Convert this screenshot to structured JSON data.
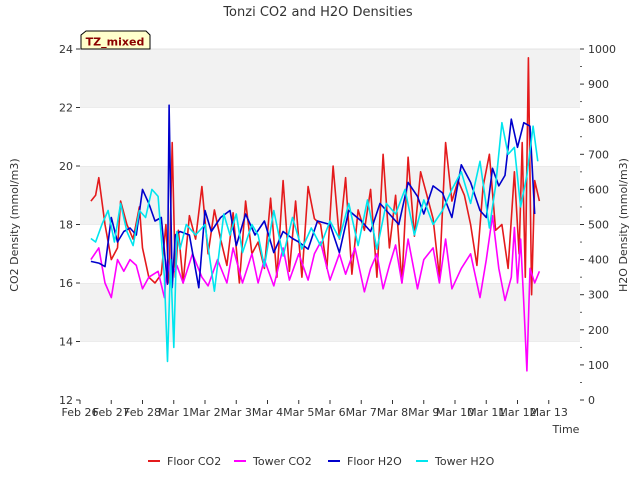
{
  "chart_data": {
    "type": "line",
    "title": "Tonzi CO2 and H2O Densities",
    "xlabel": "Time",
    "ylabel_left": "CO2 Density (mmol/m3)",
    "ylabel_right": "H2O Density (mmol/m3)",
    "ylim_left": [
      12,
      24
    ],
    "ylim_right": [
      0,
      1000
    ],
    "yticks_left": [
      "12",
      "14",
      "16",
      "18",
      "20",
      "22",
      "24"
    ],
    "yticks_right": [
      "0",
      "100",
      "200",
      "300",
      "400",
      "500",
      "600",
      "700",
      "800",
      "900",
      "1000"
    ],
    "xlim": [
      0,
      16
    ],
    "xticks": [
      "Feb 26",
      "Feb 27",
      "Feb 28",
      "Mar 1",
      "Mar 2",
      "Mar 3",
      "Mar 4",
      "Mar 5",
      "Mar 6",
      "Mar 7",
      "Mar 8",
      "Mar 9",
      "Mar 10",
      "Mar 11",
      "Mar 12",
      "Mar 13"
    ],
    "grid": "horizontal bands",
    "legend_placement": "bottom",
    "annotation": "TZ_mixed",
    "series": [
      {
        "name": "Floor CO2",
        "axis": "left",
        "color": "#e41a1c",
        "x": [
          0.35,
          0.5,
          0.6,
          0.8,
          1.0,
          1.2,
          1.3,
          1.5,
          1.7,
          1.9,
          2.0,
          2.2,
          2.4,
          2.6,
          2.75,
          2.85,
          2.95,
          3.05,
          3.15,
          3.3,
          3.5,
          3.7,
          3.9,
          4.1,
          4.3,
          4.5,
          4.7,
          4.9,
          5.1,
          5.3,
          5.5,
          5.7,
          5.9,
          6.1,
          6.3,
          6.5,
          6.7,
          6.9,
          7.1,
          7.3,
          7.5,
          7.7,
          7.9,
          8.1,
          8.3,
          8.5,
          8.7,
          8.9,
          9.1,
          9.3,
          9.5,
          9.7,
          9.9,
          10.1,
          10.3,
          10.5,
          10.7,
          10.9,
          11.1,
          11.3,
          11.5,
          11.7,
          11.9,
          12.1,
          12.3,
          12.5,
          12.7,
          12.9,
          13.1,
          13.3,
          13.5,
          13.7,
          13.9,
          14.05,
          14.15,
          14.25,
          14.35,
          14.45,
          14.55,
          14.7
        ],
        "values": [
          18.8,
          19.0,
          19.6,
          18.0,
          16.8,
          17.2,
          18.8,
          18.0,
          17.5,
          18.6,
          17.2,
          16.2,
          16.0,
          16.3,
          18.0,
          16.0,
          20.8,
          16.2,
          17.8,
          16.0,
          18.3,
          17.5,
          19.3,
          17.0,
          18.5,
          17.5,
          16.6,
          18.4,
          16.0,
          18.8,
          17.0,
          17.4,
          16.5,
          18.9,
          16.2,
          19.5,
          16.4,
          18.8,
          16.2,
          19.3,
          18.2,
          18.0,
          16.5,
          20.0,
          17.5,
          19.6,
          16.3,
          18.5,
          17.8,
          19.2,
          16.2,
          20.4,
          17.2,
          19.0,
          16.0,
          20.3,
          17.6,
          19.8,
          19.0,
          18.2,
          16.2,
          20.8,
          18.8,
          19.5,
          19.0,
          18.0,
          16.6,
          19.3,
          20.4,
          17.8,
          18.0,
          16.5,
          19.8,
          17.0,
          20.8,
          16.2,
          23.7,
          15.6,
          19.5,
          18.8
        ]
      },
      {
        "name": "Tower CO2",
        "axis": "left",
        "color": "#ff00ff",
        "x": [
          0.35,
          0.6,
          0.8,
          1.0,
          1.2,
          1.4,
          1.6,
          1.8,
          2.0,
          2.2,
          2.5,
          2.7,
          2.8,
          2.9,
          3.1,
          3.3,
          3.6,
          3.9,
          4.1,
          4.4,
          4.7,
          4.9,
          5.2,
          5.5,
          5.7,
          5.9,
          6.2,
          6.5,
          6.7,
          7.0,
          7.3,
          7.5,
          7.7,
          8.0,
          8.3,
          8.5,
          8.8,
          9.1,
          9.3,
          9.5,
          9.7,
          9.9,
          10.1,
          10.3,
          10.5,
          10.8,
          11.0,
          11.3,
          11.5,
          11.7,
          11.9,
          12.2,
          12.5,
          12.8,
          13.0,
          13.2,
          13.4,
          13.6,
          13.8,
          13.9,
          14.0,
          14.1,
          14.2,
          14.3,
          14.4,
          14.55,
          14.7
        ],
        "values": [
          16.8,
          17.2,
          16.0,
          15.5,
          16.8,
          16.4,
          16.8,
          16.6,
          15.8,
          16.2,
          16.4,
          15.5,
          16.8,
          16.2,
          16.6,
          16.0,
          17.0,
          16.2,
          15.9,
          16.8,
          16.0,
          17.2,
          16.0,
          17.0,
          16.0,
          16.8,
          15.9,
          17.2,
          16.1,
          17.0,
          16.1,
          17.0,
          17.4,
          16.1,
          17.0,
          16.3,
          17.2,
          15.7,
          16.5,
          17.0,
          15.8,
          16.6,
          17.3,
          16.0,
          17.5,
          15.8,
          16.8,
          17.2,
          16.0,
          17.5,
          15.8,
          16.5,
          17.0,
          15.5,
          16.8,
          18.3,
          16.5,
          15.4,
          16.2,
          17.9,
          16.0,
          17.5,
          15.3,
          13.0,
          16.5,
          16.0,
          16.4
        ]
      },
      {
        "name": "Floor H2O",
        "axis": "right",
        "color": "#0000cc",
        "x": [
          0.35,
          0.6,
          0.8,
          1.0,
          1.2,
          1.4,
          1.6,
          1.8,
          2.0,
          2.2,
          2.4,
          2.6,
          2.8,
          2.85,
          2.95,
          3.05,
          3.2,
          3.5,
          3.8,
          4.0,
          4.2,
          4.5,
          4.8,
          5.0,
          5.3,
          5.6,
          5.9,
          6.2,
          6.5,
          6.8,
          7.0,
          7.3,
          7.6,
          8.0,
          8.3,
          8.6,
          9.0,
          9.3,
          9.6,
          9.9,
          10.2,
          10.5,
          10.8,
          11.0,
          11.3,
          11.6,
          11.9,
          12.2,
          12.5,
          12.8,
          13.0,
          13.2,
          13.4,
          13.6,
          13.8,
          14.0,
          14.2,
          14.4,
          14.55
        ],
        "values": [
          395,
          390,
          380,
          520,
          450,
          480,
          490,
          470,
          600,
          560,
          510,
          520,
          330,
          840,
          320,
          470,
          480,
          470,
          320,
          540,
          480,
          520,
          540,
          440,
          530,
          470,
          510,
          420,
          480,
          460,
          450,
          430,
          510,
          500,
          420,
          540,
          510,
          480,
          560,
          530,
          500,
          620,
          580,
          530,
          610,
          590,
          520,
          670,
          620,
          540,
          520,
          660,
          610,
          640,
          800,
          720,
          790,
          780,
          530
        ]
      },
      {
        "name": "Tower H2O",
        "axis": "right",
        "color": "#00e5ee",
        "x": [
          0.35,
          0.5,
          0.7,
          0.9,
          1.1,
          1.3,
          1.5,
          1.7,
          1.9,
          2.1,
          2.3,
          2.5,
          2.7,
          2.8,
          2.9,
          3.0,
          3.1,
          3.2,
          3.4,
          3.7,
          4.0,
          4.3,
          4.6,
          4.8,
          5.0,
          5.2,
          5.5,
          5.7,
          5.9,
          6.2,
          6.5,
          6.8,
          7.1,
          7.4,
          7.7,
          8.0,
          8.3,
          8.6,
          8.9,
          9.2,
          9.5,
          9.8,
          10.1,
          10.4,
          10.7,
          11.0,
          11.3,
          11.6,
          11.9,
          12.2,
          12.5,
          12.8,
          13.1,
          13.3,
          13.5,
          13.7,
          13.9,
          14.1,
          14.3,
          14.5,
          14.65
        ],
        "values": [
          460,
          450,
          500,
          540,
          450,
          560,
          480,
          440,
          540,
          520,
          600,
          580,
          350,
          110,
          400,
          150,
          480,
          430,
          500,
          470,
          500,
          310,
          530,
          470,
          530,
          420,
          500,
          470,
          380,
          540,
          410,
          520,
          430,
          490,
          440,
          510,
          460,
          560,
          440,
          570,
          430,
          560,
          530,
          600,
          470,
          570,
          500,
          540,
          600,
          650,
          560,
          680,
          490,
          610,
          790,
          700,
          720,
          550,
          640,
          780,
          680
        ]
      }
    ]
  }
}
